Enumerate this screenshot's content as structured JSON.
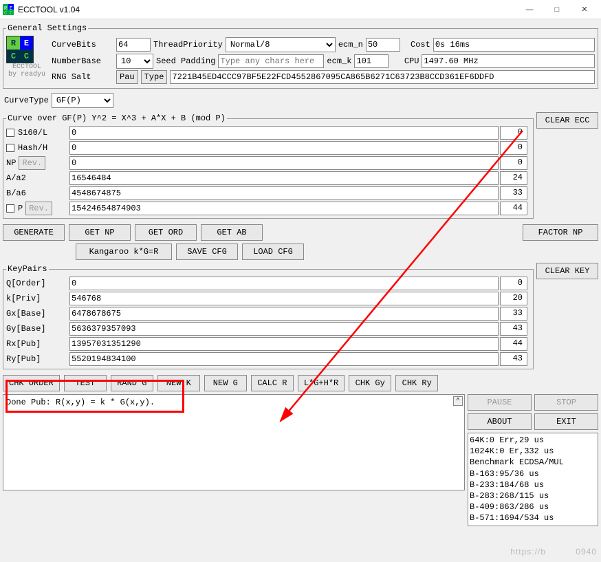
{
  "window": {
    "title": "ECCTOOL v1.04",
    "min": "—",
    "max": "□",
    "close": "✕"
  },
  "logo_text": {
    "r": "R",
    "e": "E",
    "c1": "C",
    "c2": "C",
    "name": "ECCTOOL",
    "by": "by readyu"
  },
  "general": {
    "legend": "General Settings",
    "curvebits_lbl": "CurveBits",
    "curvebits_val": "64",
    "threadpriority_lbl": "ThreadPriority",
    "threadpriority_val": "Normal/8",
    "ecm_n_lbl": "ecm_n",
    "ecm_n_val": "50",
    "cost_lbl": "Cost",
    "cost_val": "0s 16ms",
    "numberbase_lbl": "NumberBase",
    "numberbase_val": "10",
    "seedpadding_lbl": "Seed Padding",
    "seedpadding_placeholder": "Type any chars here",
    "ecm_k_lbl": "ecm_k",
    "ecm_k_val": "101",
    "cpu_lbl": "CPU",
    "cpu_val": "1497.60 MHz",
    "rngsalt_lbl": "RNG Salt",
    "pau_btn": "Pau",
    "type_btn": "Type",
    "rngsalt_val": "7221B45ED4CCC97BF5E22FCD4552867095CA865B6271C63723B8CCD361EF6DDFD"
  },
  "curvetype": {
    "lbl": "CurveType",
    "val": "GF(P)"
  },
  "curve": {
    "legend": "Curve over GF(P) Y^2 = X^3 + A*X + B (mod P)",
    "clear_btn": "CLEAR ECC",
    "rows": [
      {
        "chk": true,
        "label": "S160/L",
        "value": "0",
        "digits": "0"
      },
      {
        "chk": true,
        "label": "Hash/H",
        "value": "0",
        "digits": "0"
      },
      {
        "chk": false,
        "label": "NP",
        "rev": "Rev.",
        "value": "0",
        "digits": "0"
      },
      {
        "chk": false,
        "label": "A/a2",
        "value": "16546484",
        "digits": "24"
      },
      {
        "chk": false,
        "label": "B/a6",
        "value": "4548674875",
        "digits": "33"
      },
      {
        "chk": true,
        "label": "P",
        "rev": "Rev.",
        "value": "15424654874903",
        "digits": "44"
      }
    ],
    "btns1": [
      "GENERATE",
      "GET NP",
      "GET ORD",
      "GET AB"
    ],
    "factor_btn": "FACTOR NP",
    "btns2": [
      "Kangaroo k*G=R",
      "SAVE CFG",
      "LOAD CFG"
    ]
  },
  "keys": {
    "legend": "KeyPairs",
    "clear_btn": "CLEAR KEY",
    "rows": [
      {
        "label": "Q[Order]",
        "value": "0",
        "digits": "0"
      },
      {
        "label": "k[Priv]",
        "value": "546768",
        "digits": "20"
      },
      {
        "label": "Gx[Base]",
        "value": "6478678675",
        "digits": "33"
      },
      {
        "label": "Gy[Base]",
        "value": "5636379357093",
        "digits": "43"
      },
      {
        "label": "Rx[Pub]",
        "value": "13957031351290",
        "digits": "44"
      },
      {
        "label": "Ry[Pub]",
        "value": "5520194834100",
        "digits": "43"
      }
    ],
    "btns": [
      "CHK ORDER",
      "TEST",
      "RAND G",
      "NEW K",
      "NEW G",
      "CALC R",
      "L*G+H*R",
      "CHK Gy",
      "CHK Ry"
    ]
  },
  "right_btns": {
    "pause": "PAUSE",
    "stop": "STOP",
    "about": "ABOUT",
    "exit": "EXIT"
  },
  "log_text": "Done Pub: R(x,y) = k * G(x,y).",
  "bench_lines": [
    "64K:0 Err,29 us",
    "1024K:0 Er,332 us",
    "Benchmark ECDSA/MUL",
    "B-163:95/36 us",
    "B-233:184/68 us",
    "B-283:268/115 us",
    "B-409:863/286 us",
    "B-571:1694/534 us"
  ]
}
